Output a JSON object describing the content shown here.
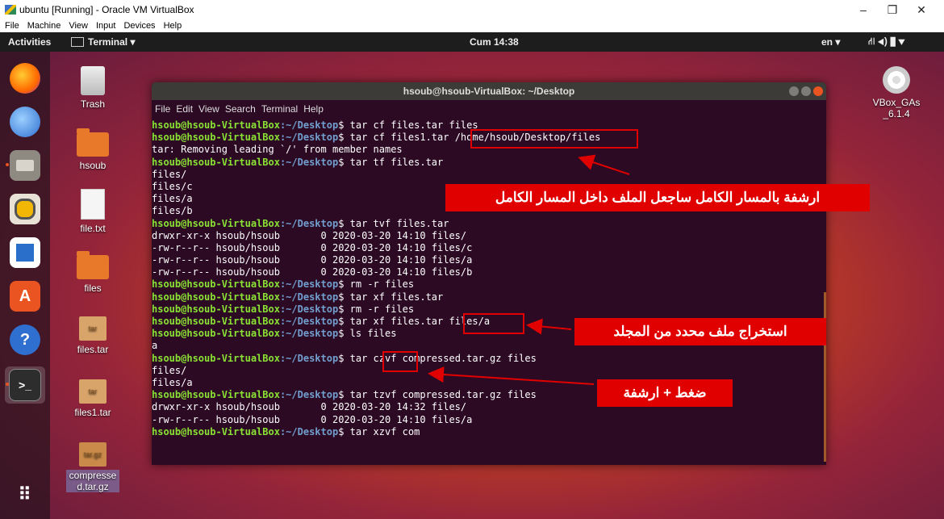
{
  "window": {
    "title": "ubuntu [Running] - Oracle VM VirtualBox",
    "controls": [
      "–",
      "❐",
      "✕"
    ]
  },
  "vbox_menu": [
    "File",
    "Machine",
    "View",
    "Input",
    "Devices",
    "Help"
  ],
  "topbar": {
    "activities": "Activities",
    "app_menu": "Terminal ▾",
    "clock": "Cum 14:38",
    "keyboard": "en ▾",
    "system": "⛙ ◂) ▮ ▾"
  },
  "desktop_icons": [
    {
      "label": "Trash"
    },
    {
      "label": "hsoub"
    },
    {
      "label": "file.txt"
    },
    {
      "label": "files"
    },
    {
      "label": "files.tar",
      "badge": "tar"
    },
    {
      "label": "files1.tar",
      "badge": "tar"
    },
    {
      "label": "compressed.tar.gz",
      "badge": "tar.gz"
    },
    {
      "label": "VBox_GAs_6.1.4"
    }
  ],
  "terminal": {
    "title": "hsoub@hsoub-VirtualBox: ~/Desktop",
    "menu": [
      "File",
      "Edit",
      "View",
      "Search",
      "Terminal",
      "Help"
    ],
    "prompt_user": "hsoub@hsoub-VirtualBox",
    "prompt_path": ":~/Desktop",
    "lines": [
      {
        "type": "cmd",
        "text": "$ tar cf files.tar files"
      },
      {
        "type": "cmd",
        "text": "$ tar cf files1.tar /home/hsoub/Desktop/files"
      },
      {
        "type": "out",
        "text": "tar: Removing leading `/' from member names"
      },
      {
        "type": "cmd",
        "text": "$ tar tf files.tar"
      },
      {
        "type": "out",
        "text": "files/"
      },
      {
        "type": "out",
        "text": "files/c"
      },
      {
        "type": "out",
        "text": "files/a"
      },
      {
        "type": "out",
        "text": "files/b"
      },
      {
        "type": "cmd",
        "text": "$ tar tvf files.tar"
      },
      {
        "type": "out",
        "text": "drwxr-xr-x hsoub/hsoub       0 2020-03-20 14:10 files/"
      },
      {
        "type": "out",
        "text": "-rw-r--r-- hsoub/hsoub       0 2020-03-20 14:10 files/c"
      },
      {
        "type": "out",
        "text": "-rw-r--r-- hsoub/hsoub       0 2020-03-20 14:10 files/a"
      },
      {
        "type": "out",
        "text": "-rw-r--r-- hsoub/hsoub       0 2020-03-20 14:10 files/b"
      },
      {
        "type": "cmd",
        "text": "$ rm -r files"
      },
      {
        "type": "cmd",
        "text": "$ tar xf files.tar"
      },
      {
        "type": "cmd",
        "text": "$ rm -r files"
      },
      {
        "type": "cmd",
        "text": "$ tar xf files.tar files/a"
      },
      {
        "type": "cmd",
        "text": "$ ls files"
      },
      {
        "type": "out",
        "text": "a"
      },
      {
        "type": "cmd",
        "text": "$ tar czvf compressed.tar.gz files"
      },
      {
        "type": "out",
        "text": "files/"
      },
      {
        "type": "out",
        "text": "files/a"
      },
      {
        "type": "cmd",
        "text": "$ tar tzvf compressed.tar.gz files"
      },
      {
        "type": "out",
        "text": "drwxr-xr-x hsoub/hsoub       0 2020-03-20 14:32 files/"
      },
      {
        "type": "out",
        "text": "-rw-r--r-- hsoub/hsoub       0 2020-03-20 14:10 files/a"
      },
      {
        "type": "cmd",
        "text": "$ tar xzvf com"
      }
    ]
  },
  "annotations": {
    "abs_path": "ارشفة بالمسار الكامل ساجعل الملف داخل المسار الكامل",
    "extract_one": "استخراج ملف محدد من المجلد",
    "compress": "ضغط + ارشفة"
  },
  "colors": {
    "prompt_user": "#8ae234",
    "prompt_path": "#729fcf",
    "terminal_bg": "#2c0a24",
    "annotation": "#e00000"
  }
}
